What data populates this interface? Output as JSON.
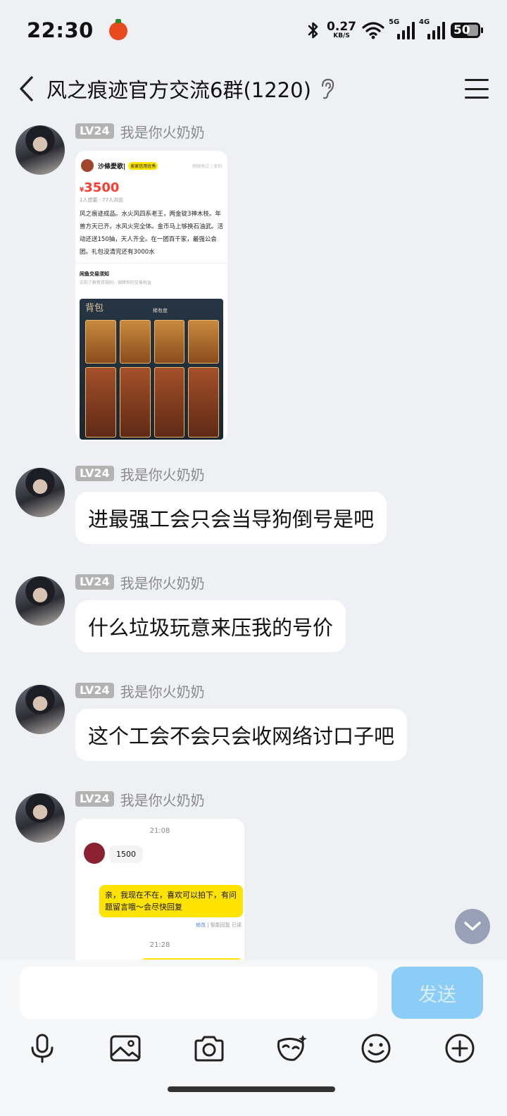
{
  "status_bar": {
    "time": "22:30",
    "net_speed_value": "0.27",
    "net_speed_unit": "KB/S",
    "signal_1_label": "5G",
    "signal_2_label": "4G",
    "battery_level": "50",
    "icons": [
      "bluetooth-icon",
      "wifi-icon",
      "cellular-signal-icon",
      "battery-icon"
    ]
  },
  "header": {
    "title": "风之痕迹官方交流6群(1220)",
    "icons": [
      "back-icon",
      "ear-icon",
      "menu-icon"
    ]
  },
  "messages": [
    {
      "level": "LV24",
      "sender": "我是你火奶奶",
      "type": "image",
      "image": {
        "seller_name": "沙條愛歌|",
        "seller_tag": "卖家信用优秀",
        "seller_seen": "刚刚来过 | 深圳",
        "price_symbol": "¥",
        "price": "3500",
        "wants": "1人想要 · 77人浏览",
        "description": "风之痕迹成品。水火风四系老王，两金锭3神木枝。年兽方天已齐。水风火完全体。金币马上够换石油武。活动还送150抽，天人齐全。在一团百千家，最强公会团。礼包没清完还有3000水",
        "notice_title": "闲鱼交易须知",
        "notice_sub": "买前了解意货规则，保障你的交易权益",
        "game_bag_title": "背包",
        "game_sort_label": "稀有度"
      }
    },
    {
      "level": "LV24",
      "sender": "我是你火奶奶",
      "type": "text",
      "text": "进最强工会只会当导狗倒号是吧"
    },
    {
      "level": "LV24",
      "sender": "我是你火奶奶",
      "type": "text",
      "text": "什么垃圾玩意来压我的号价"
    },
    {
      "level": "LV24",
      "sender": "我是你火奶奶",
      "type": "text",
      "text": "这个工会不会只会收网络讨口子吧"
    },
    {
      "level": "LV24",
      "sender": "我是你火奶奶",
      "type": "image",
      "image": {
        "time_1": "21:08",
        "incoming_text": "1500",
        "outgoing_text": "亲，我现在不在，喜欢可以拍下，有问题留言哦～会尽快回复",
        "edit_label": "修改",
        "status_label": "| 智能回复 已读",
        "time_2": "21:28"
      }
    }
  ],
  "input": {
    "placeholder": "",
    "send_label": "发送"
  },
  "toolbar": {
    "items": [
      "microphone-icon",
      "image-icon",
      "camera-icon",
      "mask-icon",
      "emoji-icon",
      "plus-icon"
    ]
  },
  "colors": {
    "background": "#eef0f3",
    "send_button": "#8ccdf7",
    "level_badge": "#b3b3b3",
    "price_red": "#ff3b30",
    "xianyu_yellow": "#ffe300"
  }
}
